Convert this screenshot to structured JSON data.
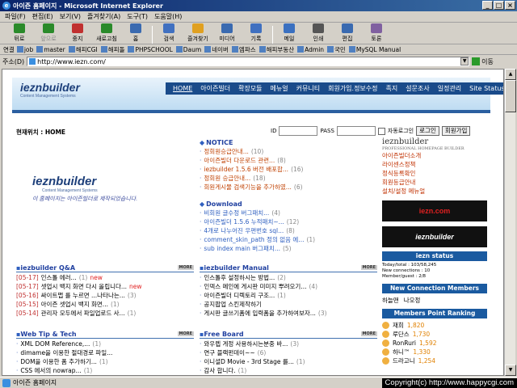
{
  "window": {
    "title": "아이즌 홈페이지 - Microsoft Internet Explorer",
    "min": "_",
    "max": "□",
    "close": "×"
  },
  "menu": [
    "파일(F)",
    "편집(E)",
    "보기(V)",
    "즐겨찾기(A)",
    "도구(T)",
    "도움말(H)"
  ],
  "toolbar": [
    {
      "label": "뒤로",
      "icon": "back-icon",
      "dis": false
    },
    {
      "label": "앞으로",
      "icon": "forward-icon",
      "dis": true
    },
    {
      "label": "중지",
      "icon": "stop-icon",
      "dis": false
    },
    {
      "label": "새로고침",
      "icon": "refresh-icon",
      "dis": false
    },
    {
      "label": "홈",
      "icon": "home-icon",
      "dis": false
    },
    {
      "label": "검색",
      "icon": "search-icon",
      "dis": false
    },
    {
      "label": "즐겨찾기",
      "icon": "favorites-icon",
      "dis": false
    },
    {
      "label": "미디어",
      "icon": "media-icon",
      "dis": false
    },
    {
      "label": "기록",
      "icon": "history-icon",
      "dis": false
    },
    {
      "label": "메일",
      "icon": "mail-icon",
      "dis": false
    },
    {
      "label": "인쇄",
      "icon": "print-icon",
      "dis": false
    },
    {
      "label": "편집",
      "icon": "edit-icon",
      "dis": false
    },
    {
      "label": "토론",
      "icon": "discuss-icon",
      "dis": false
    }
  ],
  "links": {
    "label": "연결",
    "items": [
      "job",
      "master",
      "해피CGI",
      "해피돌",
      "PHPSCHOOL",
      "Daum",
      "네이버",
      "엠파스",
      "해피부동산",
      "Admin",
      "국민",
      "MySQL Manual"
    ]
  },
  "address": {
    "label": "주소(D)",
    "url": "http://www.iezn.com/",
    "go": "이동"
  },
  "site": {
    "logo": "ieznbuilder",
    "logo_sub": "Content Management Systems",
    "nav": [
      "HOME",
      "아이즌빌더",
      "확장모듈",
      "메뉴얼",
      "커뮤니티",
      "회원가입.정보수정",
      "족지",
      "설문조사",
      "일정관리",
      "Site Status"
    ],
    "location": "현재위치 : HOME",
    "login": {
      "id": "ID",
      "pass": "PASS",
      "auto": "자동로그인",
      "login_btn": "로그인",
      "join_btn": "회원가입"
    },
    "main_logo": "ieznbuilder",
    "main_logo_sub": "Content Management Systems",
    "main_slogan": "이 홈페이지는 아이즌빌더로 제작되었습니다.",
    "notice": {
      "title": "NOTICE",
      "items": [
        {
          "t": "정회원승급안내...",
          "c": "(10)"
        },
        {
          "t": "아이즌빌더 다운로드 관련...",
          "c": "(8)"
        },
        {
          "t": "iezbuilder 1.5.6 버전 배포합...",
          "c": "(16)"
        },
        {
          "t": "정회원 승급안내...",
          "c": "(18)"
        },
        {
          "t": "회원게시물 검색기능을 추가하였...",
          "c": "(6)"
        }
      ]
    },
    "download": {
      "title": "Download",
      "items": [
        {
          "t": "비회원 글수정 버그패치...",
          "c": "(4)"
        },
        {
          "t": "아이즌빌더 1.5.6 누적패치~...",
          "c": "(12)"
        },
        {
          "t": "4개로 나누어진 우편번호 sql...",
          "c": "(8)"
        },
        {
          "t": "comment_skin_path 정의 없음 에...",
          "c": "(1)"
        },
        {
          "t": "sub index main 버그패치...",
          "c": "(5)"
        }
      ]
    },
    "qa": {
      "title": "iezbuilder Q&A",
      "more": "MORE",
      "items": [
        {
          "d": "[05-17]",
          "t": "인스톨 에러...",
          "c": "(1)",
          "n": "new"
        },
        {
          "d": "[05-17]",
          "t": "셋업시 백지 화면 다시 올립니다...",
          "c": "",
          "n": "new"
        },
        {
          "d": "[05-16]",
          "t": "싸이트맵 를 누르면 ...나타나는...",
          "c": "(3)",
          "n": ""
        },
        {
          "d": "[05-15]",
          "t": "아이즌 셋업시 백지 화면...",
          "c": "(1)",
          "n": ""
        },
        {
          "d": "[05-14]",
          "t": "관리자 모두에서 파일업로드 사...",
          "c": "(1)",
          "n": ""
        }
      ]
    },
    "manual": {
      "title": "iezbuilder Manual",
      "more": "MORE",
      "items": [
        {
          "t": "인스톨후 설정하시는 방법...",
          "c": "(2)"
        },
        {
          "t": "인덱스 메인에 게시판 미미지 뿌려오기...",
          "c": "(4)"
        },
        {
          "t": "아이즌빌더 디렉토리 구조...",
          "c": "(1)"
        },
        {
          "t": "공지팝업 스킨제작하기",
          "c": ""
        },
        {
          "t": "게시판 글쓰기폼에 입력폼을 추가하여보자...",
          "c": "(3)"
        }
      ]
    },
    "webtip": {
      "title": "Web Tip & Tech",
      "more": "MORE",
      "items": [
        {
          "t": "XML DOM Reference,...",
          "c": "(1)"
        },
        {
          "t": "dimame을 이용한 절대경로 파일...",
          "c": ""
        },
        {
          "t": "DOM을 이용한 폼 추가하기...",
          "c": "(1)"
        },
        {
          "t": "CSS 에서의 nowrap...",
          "c": "(1)"
        }
      ]
    },
    "freeboard": {
      "title": "Free Board",
      "more": "MORE",
      "items": [
        {
          "t": "와우렙 게정 사용하시는분중 바...",
          "c": "(3)"
        },
        {
          "t": "연구 블랙펀데이~~",
          "c": "(6)"
        },
        {
          "t": "이니셜D Movie - 3rd Stage 를...",
          "c": "(1)"
        },
        {
          "t": "감사 합니다.",
          "c": "(1)"
        }
      ]
    },
    "right": {
      "title": "ieznbuilder",
      "sub": "PROFESSIONAL HOMEPAGE BUILDER",
      "links": [
        "아이즌빌더소개",
        "라이센스정책",
        "정식등록확인",
        "회원등급안내",
        "설치/설정 메뉴얼"
      ],
      "banner1": "iezn.com",
      "banner2": "ieznbuilder",
      "status_title": "iezn status",
      "status_lines": [
        "Today/total : 103/58,245",
        "New connections : 10",
        "Member/guest : 2/8"
      ],
      "newconn_title": "New Connection Members",
      "newconn": [
        "하늘맨",
        "나오정"
      ],
      "rank_title": "Members Point Ranking",
      "ranks": [
        {
          "n": "재희",
          "p": "1,820"
        },
        {
          "n": "루단스",
          "p": "1,730"
        },
        {
          "n": "RonRuri",
          "p": "1,592"
        },
        {
          "n": "하니™",
          "p": "1,330"
        },
        {
          "n": "드라고니",
          "p": "1,254"
        }
      ]
    }
  },
  "status": {
    "text": "아이즌 홈페이지",
    "copyright": "Copyright(c) http://www.happycgi.com"
  }
}
